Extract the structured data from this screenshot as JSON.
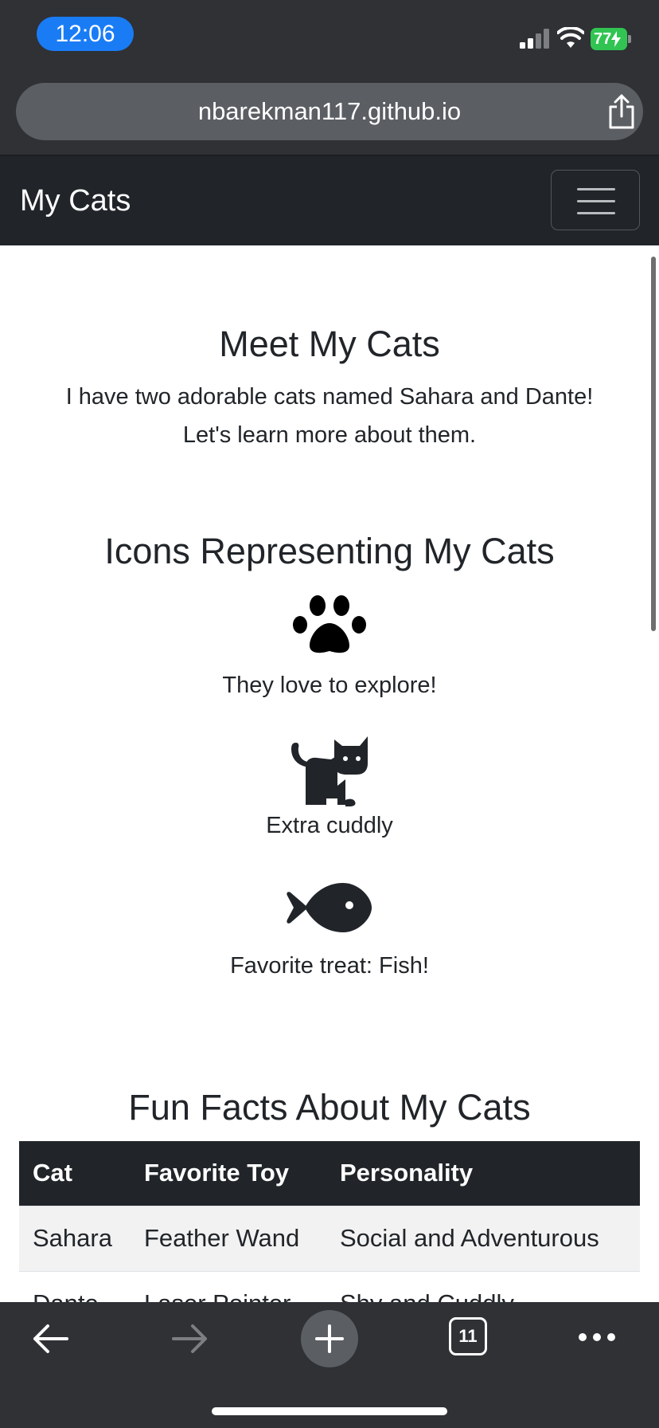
{
  "status_bar": {
    "time": "12:06",
    "battery_level": "77"
  },
  "browser": {
    "url": "nbarekman117.github.io",
    "open_tabs_count": "11"
  },
  "navbar": {
    "brand": "My Cats"
  },
  "main": {
    "intro": {
      "title": "Meet My Cats",
      "line1": "I have two adorable cats named Sahara and Dante!",
      "line2": "Let's learn more about them."
    },
    "icons_section": {
      "title": "Icons Representing My Cats",
      "items": [
        {
          "icon": "paw-icon",
          "caption": "They love to explore!"
        },
        {
          "icon": "cat-icon",
          "caption": "Extra cuddly"
        },
        {
          "icon": "fish-icon",
          "caption": "Favorite treat: Fish!"
        }
      ]
    },
    "facts_section": {
      "title": "Fun Facts About My Cats",
      "headers": [
        "Cat",
        "Favorite Toy",
        "Personality"
      ],
      "rows": [
        [
          "Sahara",
          "Feather Wand",
          "Social and Adventurous"
        ],
        [
          "Dante",
          "Laser Pointer",
          "Shy and Cuddly"
        ]
      ]
    }
  },
  "colors": {
    "navbar_bg": "#212529",
    "time_pill": "#1a7cf5",
    "battery": "#31c452",
    "browser_chrome": "#2f3135"
  }
}
